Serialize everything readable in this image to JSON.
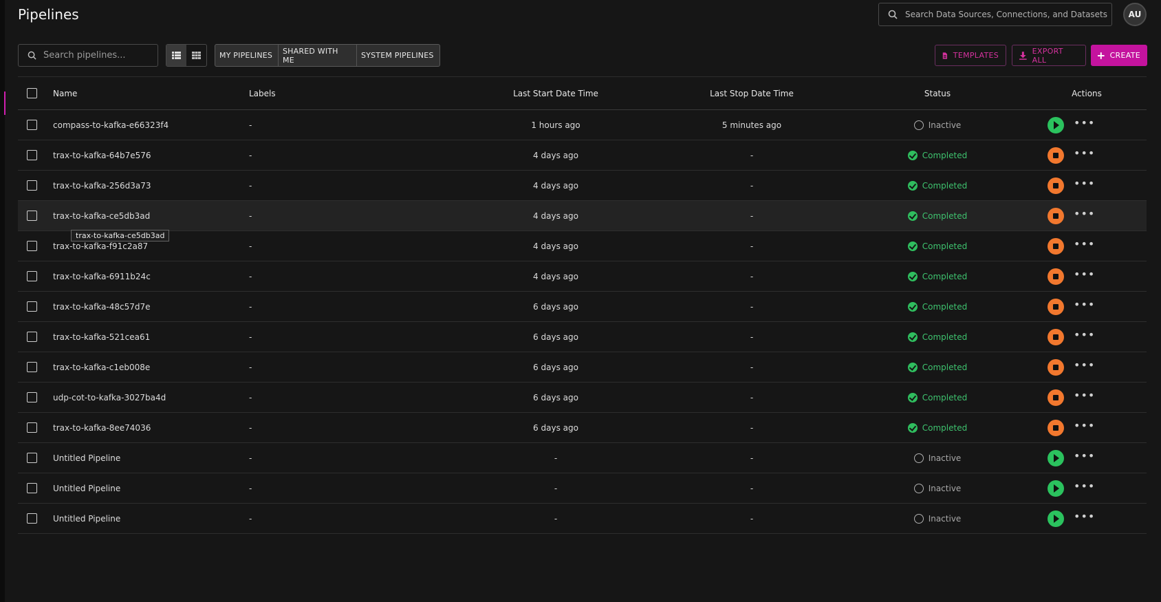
{
  "header": {
    "title": "Pipelines",
    "global_search_placeholder": "Search Data Sources, Connections, and Datasets",
    "avatar_initials": "AU"
  },
  "toolbar": {
    "search_placeholder": "Search pipelines...",
    "view_modes": [
      "list-view-icon",
      "grid-view-icon"
    ],
    "active_view": "list",
    "filters": [
      "MY PIPELINES",
      "SHARED WITH ME",
      "SYSTEM PIPELINES"
    ],
    "templates_label": "TEMPLATES",
    "export_label": "EXPORT ALL",
    "create_label": "CREATE"
  },
  "colors": {
    "accent": "#c4139e",
    "completed": "#3ec26e",
    "stop": "#f2782e",
    "play": "#2bc25e"
  },
  "table": {
    "columns": {
      "name": "Name",
      "labels": "Labels",
      "start": "Last Start Date Time",
      "stop": "Last Stop Date Time",
      "status": "Status",
      "actions": "Actions"
    },
    "rows": [
      {
        "name": "compass-to-kafka-e66323f4",
        "labels": "-",
        "start": "1 hours ago",
        "stop": "5 minutes ago",
        "status": "Inactive",
        "action": "play"
      },
      {
        "name": "trax-to-kafka-64b7e576",
        "labels": "-",
        "start": "4 days ago",
        "stop": "-",
        "status": "Completed",
        "action": "stop"
      },
      {
        "name": "trax-to-kafka-256d3a73",
        "labels": "-",
        "start": "4 days ago",
        "stop": "-",
        "status": "Completed",
        "action": "stop"
      },
      {
        "name": "trax-to-kafka-ce5db3ad",
        "labels": "-",
        "start": "4 days ago",
        "stop": "-",
        "status": "Completed",
        "action": "stop"
      },
      {
        "name": "trax-to-kafka-f91c2a87",
        "labels": "-",
        "start": "4 days ago",
        "stop": "-",
        "status": "Completed",
        "action": "stop"
      },
      {
        "name": "trax-to-kafka-6911b24c",
        "labels": "-",
        "start": "4 days ago",
        "stop": "-",
        "status": "Completed",
        "action": "stop"
      },
      {
        "name": "trax-to-kafka-48c57d7e",
        "labels": "-",
        "start": "6 days ago",
        "stop": "-",
        "status": "Completed",
        "action": "stop"
      },
      {
        "name": "trax-to-kafka-521cea61",
        "labels": "-",
        "start": "6 days ago",
        "stop": "-",
        "status": "Completed",
        "action": "stop"
      },
      {
        "name": "trax-to-kafka-c1eb008e",
        "labels": "-",
        "start": "6 days ago",
        "stop": "-",
        "status": "Completed",
        "action": "stop"
      },
      {
        "name": "udp-cot-to-kafka-3027ba4d",
        "labels": "-",
        "start": "6 days ago",
        "stop": "-",
        "status": "Completed",
        "action": "stop"
      },
      {
        "name": "trax-to-kafka-8ee74036",
        "labels": "-",
        "start": "6 days ago",
        "stop": "-",
        "status": "Completed",
        "action": "stop"
      },
      {
        "name": "Untitled Pipeline",
        "labels": "-",
        "start": "-",
        "stop": "-",
        "status": "Inactive",
        "action": "play"
      },
      {
        "name": "Untitled Pipeline",
        "labels": "-",
        "start": "-",
        "stop": "-",
        "status": "Inactive",
        "action": "play"
      },
      {
        "name": "Untitled Pipeline",
        "labels": "-",
        "start": "-",
        "stop": "-",
        "status": "Inactive",
        "action": "play"
      }
    ],
    "hovered_row": 3,
    "tooltip": "trax-to-kafka-ce5db3ad"
  }
}
